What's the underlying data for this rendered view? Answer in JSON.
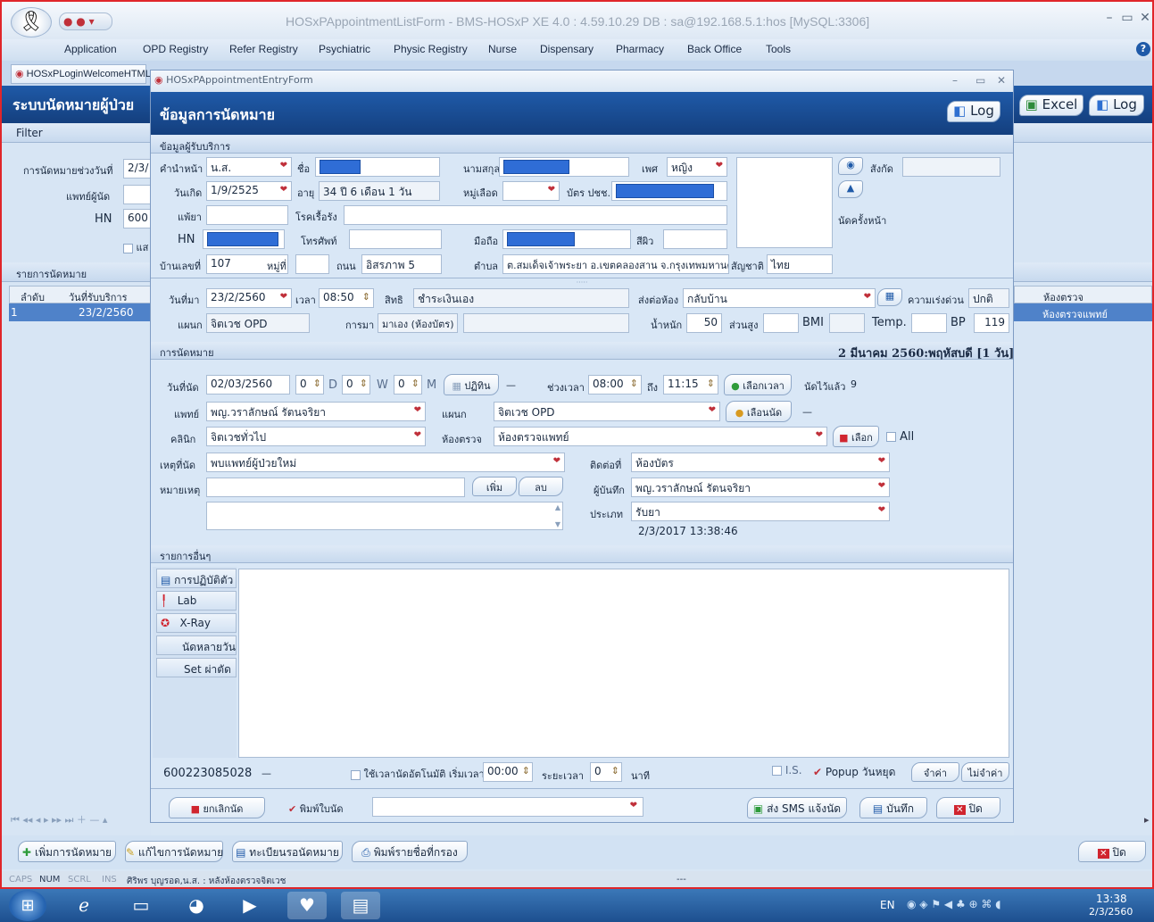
{
  "window": {
    "title": "HOSxPAppointmentListForm - BMS-HOSxP XE 4.0 : 4.59.10.29 DB : sa@192.168.5.1:hos [MySQL:3306]"
  },
  "menu": [
    "Application",
    "OPD Registry",
    "Refer Registry",
    "Psychiatric",
    "Physic Registry",
    "Nurse",
    "Dispensary",
    "Pharmacy",
    "Back Office",
    "Tools"
  ],
  "tabs": {
    "welcome": "HOSxPLoginWelcomeHTML",
    "entry": "HOSxPAppointmentEntryForm"
  },
  "left": {
    "title": "ระบบนัดหมายผู้ป่วย",
    "filter": "Filter",
    "range_label": "การนัดหมายช่วงวันที่",
    "range_value": "2/3/",
    "doctor_label": "แพทย์ผู้นัด",
    "hn_label": "HN",
    "hn_value": "600",
    "check_label": "แส",
    "list_label": "รายการนัดหมาย",
    "col_no": "ลำดับ",
    "col_date": "วันที่รับบริการ",
    "row_no": "1",
    "row_date": "23/2/2560"
  },
  "right": {
    "excel": "Excel",
    "log": "Log",
    "col_room": "ห้องตรวจ",
    "row_room": "ห้องตรวจแพทย์"
  },
  "dialog": {
    "heading": "ข้อมูลการนัดหมาย",
    "log": "Log",
    "patient": {
      "section": "ข้อมูลผู้รับบริการ",
      "prefix_label": "คำนำหน้า",
      "prefix": "น.ส.",
      "name_label": "ชื่อ",
      "surname_label": "นามสกุล",
      "sex_label": "เพศ",
      "sex": "หญิง",
      "affil_label": "สังกัด",
      "dob_label": "วันเกิด",
      "dob": "1/9/2525",
      "age_label": "อายุ",
      "age": "34 ปี 6 เดือน 1 วัน",
      "blood_label": "หมู่เลือด",
      "cid_label": "บัตร ปชช.",
      "allergy_label": "แพ้ยา",
      "chronic_label": "โรคเรื้อรัง",
      "next_label": "นัดครั้งหน้า",
      "hn_label": "HN",
      "phone_label": "โทรศัพท์",
      "mobile_label": "มือถือ",
      "skin_label": "สีผิว",
      "house_label": "บ้านเลขที่",
      "house": "107",
      "moo_label": "หมู่ที่",
      "road_label": "ถนน",
      "road": "อิสรภาพ 5",
      "tambon_label": "ตำบล",
      "tambon": "ต.สมเด็จเจ้าพระยา อ.เขตคลองสาน จ.กรุงเทพมหานคร",
      "nation_label": "สัญชาติ",
      "nation": "ไทย",
      "visit_label": "วันที่มา",
      "visit": "23/2/2560",
      "time_label": "เวลา",
      "time": "08:50",
      "right_label": "สิทธิ",
      "right": "ชำระเงินเอง",
      "send_label": "ส่งต่อห้อง",
      "send": "กลับบ้าน",
      "urgency_label": "ความเร่งด่วน",
      "urgency": "ปกติ",
      "dept_label": "แผนก",
      "dept": "จิตเวช OPD",
      "come_label": "การมา",
      "come": "มาเอง (ห้องบัตร)",
      "weight_label": "น้ำหนัก",
      "weight": "50",
      "height_label": "ส่วนสูง",
      "bmi_label": "BMI",
      "temp_label": "Temp.",
      "bp_label": "BP",
      "bp": "119"
    },
    "appt": {
      "section": "การนัดหมาย",
      "summary": "2 มีนาคม 2560:พฤหัสบดี  [1 วัน]",
      "date_label": "วันที่นัด",
      "date": "02/03/2560",
      "d": "0",
      "d_unit": "D",
      "w": "0",
      "w_unit": "W",
      "m": "0",
      "m_unit": "M",
      "calendar_btn": "ปฏิทิน",
      "dash": "—",
      "period_label": "ช่วงเวลา",
      "from": "08:00",
      "to_label": "ถึง",
      "to": "11:15",
      "pick_time_btn": "เลือกเวลา",
      "booked_label": "นัดไว้แล้ว",
      "booked": "9",
      "doctor_label": "แพทย์",
      "doctor": "พญ.วราลักษณ์ รัตนจริยา",
      "dept_label": "แผนก",
      "dept": "จิตเวช OPD",
      "pick_appt_btn": "เลือนนัด",
      "clinic_label": "คลินิก",
      "clinic": "จิตเวชทั่วไป",
      "room_label": "ห้องตรวจ",
      "room": "ห้องตรวจแพทย์",
      "select_btn": "เลือก",
      "all_label": "All",
      "reason_label": "เหตุที่นัด",
      "reason": "พบแพทย์ผู้ป่วยใหม่",
      "contact_label": "ติดต่อที่",
      "contact": "ห้องบัตร",
      "note_label": "หมายเหตุ",
      "add_btn": "เพิ่ม",
      "del_btn": "ลบ",
      "recorder_label": "ผู้บันทึก",
      "recorder": "พญ.วราลักษณ์ รัตนจริยา",
      "type_label": "ประเภท",
      "type": "รับยา",
      "stamp": "2/3/2017 13:38:46"
    },
    "other": {
      "section": "รายการอื่นๆ",
      "items": [
        "การปฏิบัติตัว",
        "Lab",
        "X-Ray",
        "นัดหลายวัน",
        "Set ผ่าตัด"
      ]
    },
    "footer": {
      "number": "600223085028",
      "dash": "—",
      "auto_label": "ใช้เวลานัดอัตโนมัติ เริ่มเวลา",
      "auto_time": "00:00",
      "interval_label": "ระยะเวลา",
      "interval": "0",
      "minute": "นาที",
      "is_label": "I.S.",
      "popup_label": "Popup วันหยุด",
      "remember_btn": "จำค่า",
      "forget_btn": "ไม่จำค่า",
      "cancel_btn": "ยกเลิกนัด",
      "print_label": "พิมพ์ใบนัด",
      "sms_btn": "ส่ง SMS แจ้งนัด",
      "save_btn": "บันทึก",
      "close_btn": "ปิด"
    }
  },
  "bottom": {
    "add": "เพิ่มการนัดหมาย",
    "edit": "แก้ไขการนัดหมาย",
    "register": "ทะเบียนรอนัดหมาย",
    "print": "พิมพ์รายชื่อที่กรอง",
    "close": "ปิด"
  },
  "status": {
    "caps": "CAPS",
    "num": "NUM",
    "scrl": "SCRL",
    "ins": "INS",
    "text": "ศิริพร บุญรอด,น.ส. : หลังห้องตรวจจิตเวช",
    "dash": "---"
  },
  "taskbar": {
    "lang": "EN",
    "time": "13:38",
    "date": "2/3/2560"
  }
}
